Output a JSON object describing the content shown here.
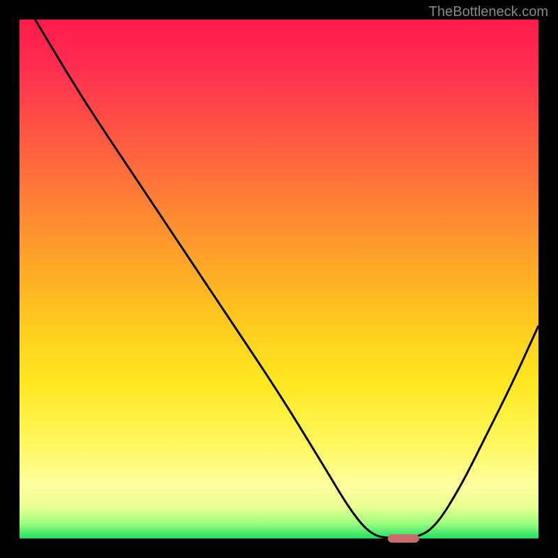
{
  "watermark": "TheBottleneck.com",
  "chart_data": {
    "type": "line",
    "title": "",
    "xlabel": "",
    "ylabel": "",
    "xlim": [
      0,
      100
    ],
    "ylim": [
      0,
      100
    ],
    "gradient_stops": [
      {
        "pos": 0.0,
        "color": "#ff1a4d"
      },
      {
        "pos": 0.1,
        "color": "#ff3050"
      },
      {
        "pos": 0.25,
        "color": "#ff6040"
      },
      {
        "pos": 0.4,
        "color": "#ff9030"
      },
      {
        "pos": 0.55,
        "color": "#ffc020"
      },
      {
        "pos": 0.7,
        "color": "#ffe820"
      },
      {
        "pos": 0.82,
        "color": "#fff860"
      },
      {
        "pos": 0.9,
        "color": "#ffffa0"
      },
      {
        "pos": 0.94,
        "color": "#e8ff90"
      },
      {
        "pos": 0.97,
        "color": "#a0ff80"
      },
      {
        "pos": 1.0,
        "color": "#20e060"
      }
    ],
    "series": [
      {
        "name": "bottleneck-curve",
        "points": [
          {
            "x": 3,
            "y": 100
          },
          {
            "x": 12,
            "y": 85
          },
          {
            "x": 22,
            "y": 70
          },
          {
            "x": 30,
            "y": 58
          },
          {
            "x": 40,
            "y": 43
          },
          {
            "x": 50,
            "y": 28
          },
          {
            "x": 58,
            "y": 15
          },
          {
            "x": 64,
            "y": 5
          },
          {
            "x": 68,
            "y": 0.5
          },
          {
            "x": 72,
            "y": 0
          },
          {
            "x": 76,
            "y": 0
          },
          {
            "x": 80,
            "y": 2
          },
          {
            "x": 85,
            "y": 10
          },
          {
            "x": 90,
            "y": 20
          },
          {
            "x": 95,
            "y": 30
          },
          {
            "x": 100,
            "y": 41
          }
        ]
      }
    ],
    "marker": {
      "x": 74,
      "y": 0,
      "width_pct": 6,
      "height_pct": 1.5
    }
  }
}
